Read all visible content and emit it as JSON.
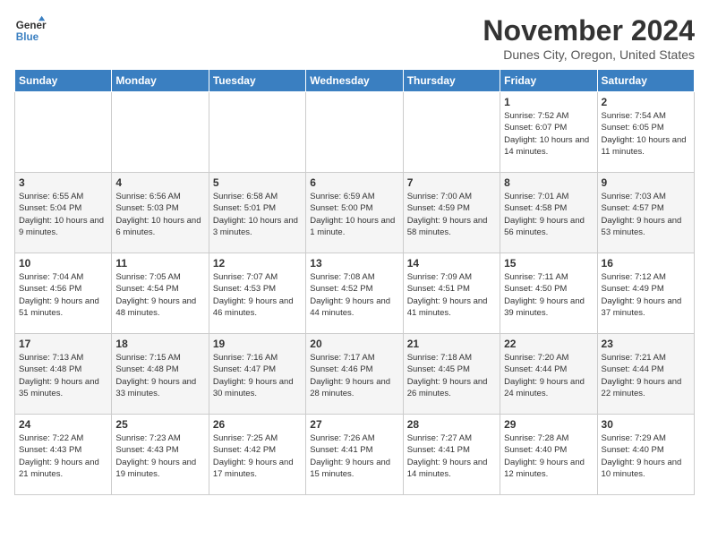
{
  "header": {
    "logo_line1": "General",
    "logo_line2": "Blue",
    "month": "November 2024",
    "location": "Dunes City, Oregon, United States"
  },
  "weekdays": [
    "Sunday",
    "Monday",
    "Tuesday",
    "Wednesday",
    "Thursday",
    "Friday",
    "Saturday"
  ],
  "weeks": [
    [
      {
        "day": "",
        "info": ""
      },
      {
        "day": "",
        "info": ""
      },
      {
        "day": "",
        "info": ""
      },
      {
        "day": "",
        "info": ""
      },
      {
        "day": "",
        "info": ""
      },
      {
        "day": "1",
        "info": "Sunrise: 7:52 AM\nSunset: 6:07 PM\nDaylight: 10 hours and 14 minutes."
      },
      {
        "day": "2",
        "info": "Sunrise: 7:54 AM\nSunset: 6:05 PM\nDaylight: 10 hours and 11 minutes."
      }
    ],
    [
      {
        "day": "3",
        "info": "Sunrise: 6:55 AM\nSunset: 5:04 PM\nDaylight: 10 hours and 9 minutes."
      },
      {
        "day": "4",
        "info": "Sunrise: 6:56 AM\nSunset: 5:03 PM\nDaylight: 10 hours and 6 minutes."
      },
      {
        "day": "5",
        "info": "Sunrise: 6:58 AM\nSunset: 5:01 PM\nDaylight: 10 hours and 3 minutes."
      },
      {
        "day": "6",
        "info": "Sunrise: 6:59 AM\nSunset: 5:00 PM\nDaylight: 10 hours and 1 minute."
      },
      {
        "day": "7",
        "info": "Sunrise: 7:00 AM\nSunset: 4:59 PM\nDaylight: 9 hours and 58 minutes."
      },
      {
        "day": "8",
        "info": "Sunrise: 7:01 AM\nSunset: 4:58 PM\nDaylight: 9 hours and 56 minutes."
      },
      {
        "day": "9",
        "info": "Sunrise: 7:03 AM\nSunset: 4:57 PM\nDaylight: 9 hours and 53 minutes."
      }
    ],
    [
      {
        "day": "10",
        "info": "Sunrise: 7:04 AM\nSunset: 4:56 PM\nDaylight: 9 hours and 51 minutes."
      },
      {
        "day": "11",
        "info": "Sunrise: 7:05 AM\nSunset: 4:54 PM\nDaylight: 9 hours and 48 minutes."
      },
      {
        "day": "12",
        "info": "Sunrise: 7:07 AM\nSunset: 4:53 PM\nDaylight: 9 hours and 46 minutes."
      },
      {
        "day": "13",
        "info": "Sunrise: 7:08 AM\nSunset: 4:52 PM\nDaylight: 9 hours and 44 minutes."
      },
      {
        "day": "14",
        "info": "Sunrise: 7:09 AM\nSunset: 4:51 PM\nDaylight: 9 hours and 41 minutes."
      },
      {
        "day": "15",
        "info": "Sunrise: 7:11 AM\nSunset: 4:50 PM\nDaylight: 9 hours and 39 minutes."
      },
      {
        "day": "16",
        "info": "Sunrise: 7:12 AM\nSunset: 4:49 PM\nDaylight: 9 hours and 37 minutes."
      }
    ],
    [
      {
        "day": "17",
        "info": "Sunrise: 7:13 AM\nSunset: 4:48 PM\nDaylight: 9 hours and 35 minutes."
      },
      {
        "day": "18",
        "info": "Sunrise: 7:15 AM\nSunset: 4:48 PM\nDaylight: 9 hours and 33 minutes."
      },
      {
        "day": "19",
        "info": "Sunrise: 7:16 AM\nSunset: 4:47 PM\nDaylight: 9 hours and 30 minutes."
      },
      {
        "day": "20",
        "info": "Sunrise: 7:17 AM\nSunset: 4:46 PM\nDaylight: 9 hours and 28 minutes."
      },
      {
        "day": "21",
        "info": "Sunrise: 7:18 AM\nSunset: 4:45 PM\nDaylight: 9 hours and 26 minutes."
      },
      {
        "day": "22",
        "info": "Sunrise: 7:20 AM\nSunset: 4:44 PM\nDaylight: 9 hours and 24 minutes."
      },
      {
        "day": "23",
        "info": "Sunrise: 7:21 AM\nSunset: 4:44 PM\nDaylight: 9 hours and 22 minutes."
      }
    ],
    [
      {
        "day": "24",
        "info": "Sunrise: 7:22 AM\nSunset: 4:43 PM\nDaylight: 9 hours and 21 minutes."
      },
      {
        "day": "25",
        "info": "Sunrise: 7:23 AM\nSunset: 4:43 PM\nDaylight: 9 hours and 19 minutes."
      },
      {
        "day": "26",
        "info": "Sunrise: 7:25 AM\nSunset: 4:42 PM\nDaylight: 9 hours and 17 minutes."
      },
      {
        "day": "27",
        "info": "Sunrise: 7:26 AM\nSunset: 4:41 PM\nDaylight: 9 hours and 15 minutes."
      },
      {
        "day": "28",
        "info": "Sunrise: 7:27 AM\nSunset: 4:41 PM\nDaylight: 9 hours and 14 minutes."
      },
      {
        "day": "29",
        "info": "Sunrise: 7:28 AM\nSunset: 4:40 PM\nDaylight: 9 hours and 12 minutes."
      },
      {
        "day": "30",
        "info": "Sunrise: 7:29 AM\nSunset: 4:40 PM\nDaylight: 9 hours and 10 minutes."
      }
    ]
  ]
}
